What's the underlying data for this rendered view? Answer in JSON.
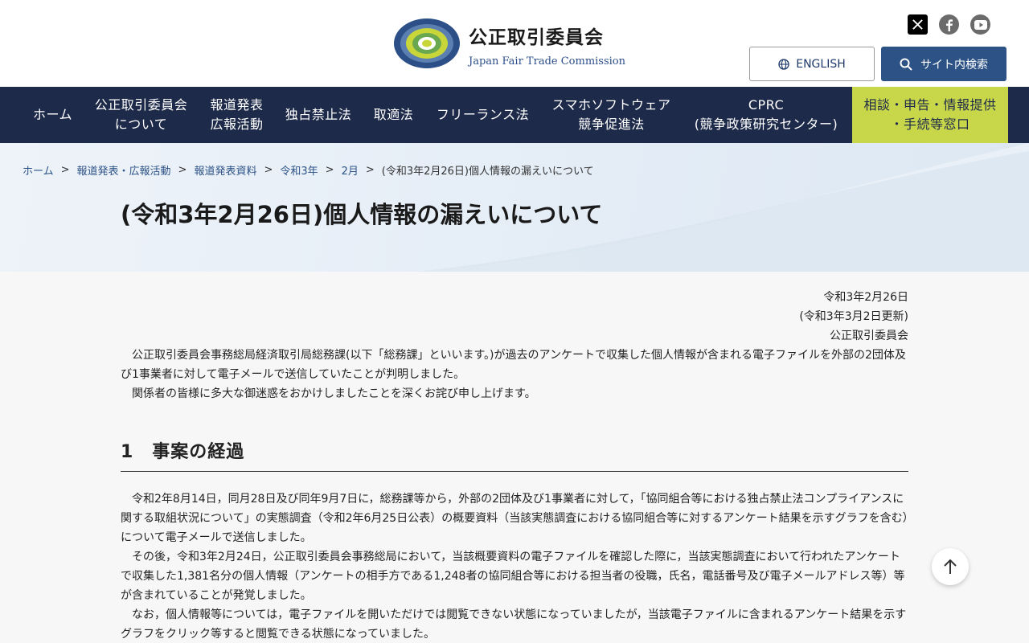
{
  "header": {
    "logo_ja": "公正取引委員会",
    "logo_en": "Japan Fair Trade Commission",
    "english_label": "ENGLISH",
    "search_label": "サイト内検索"
  },
  "social": [
    "x-icon",
    "facebook-icon",
    "youtube-icon"
  ],
  "nav": [
    {
      "l1": "ホーム",
      "l2": ""
    },
    {
      "l1": "公正取引委員会",
      "l2": "について"
    },
    {
      "l1": "報道発表",
      "l2": "広報活動"
    },
    {
      "l1": "独占禁止法",
      "l2": ""
    },
    {
      "l1": "取適法",
      "l2": ""
    },
    {
      "l1": "フリーランス法",
      "l2": ""
    },
    {
      "l1": "スマホソフトウェア",
      "l2": "競争促進法"
    },
    {
      "l1": "CPRC",
      "l2": "(競争政策研究センター)"
    },
    {
      "l1": "相談・申告・情報提供",
      "l2": "・手続等窓口"
    }
  ],
  "breadcrumb": [
    "ホーム",
    "報道発表・広報活動",
    "報道発表資料",
    "令和3年",
    "2月",
    "(令和3年2月26日)個人情報の漏えいについて"
  ],
  "title": "(令和3年2月26日)個人情報の漏えいについて",
  "meta": {
    "date": "令和3年2月26日",
    "updated": "(令和3年3月2日更新)",
    "org": "公正取引委員会"
  },
  "intro": [
    "公正取引委員会事務総局経済取引局総務課(以下「総務課」といいます。)が過去のアンケートで収集した個人情報が含まれる電子ファイルを外部の2団体及び1事業者に対して電子メールで送信していたことが判明しました。",
    "関係者の皆様に多大な御迷惑をおかけしましたことを深くお詫び申し上げます。"
  ],
  "section1": {
    "heading": "1　事案の経過",
    "paras": [
      "令和2年8月14日，同月28日及び同年9月7日に，総務課等から，外部の2団体及び1事業者に対して，「協同組合等における独占禁止法コンプライアンスに関する取組状況について」の実態調査（令和2年6月25日公表）の概要資料（当該実態調査における協同組合等に対するアンケート結果を示すグラフを含む）について電子メールで送信しました。",
      "その後，令和3年2月24日，公正取引委員会事務総局において，当該概要資料の電子ファイルを確認した際に，当該実態調査において行われたアンケートで収集した1,381名分の個人情報（アンケートの相手方である1,248者の協同組合等における担当者の役職，氏名，電話番号及び電子メールアドレス等）等が含まれていることが発覚しました。",
      "なお，個人情報等については，電子ファイルを開いただけでは閲覧できない状態になっていましたが，当該電子ファイルに含まれるアンケート結果を示すグラフをクリック等すると閲覧できる状態になっていました。"
    ]
  }
}
